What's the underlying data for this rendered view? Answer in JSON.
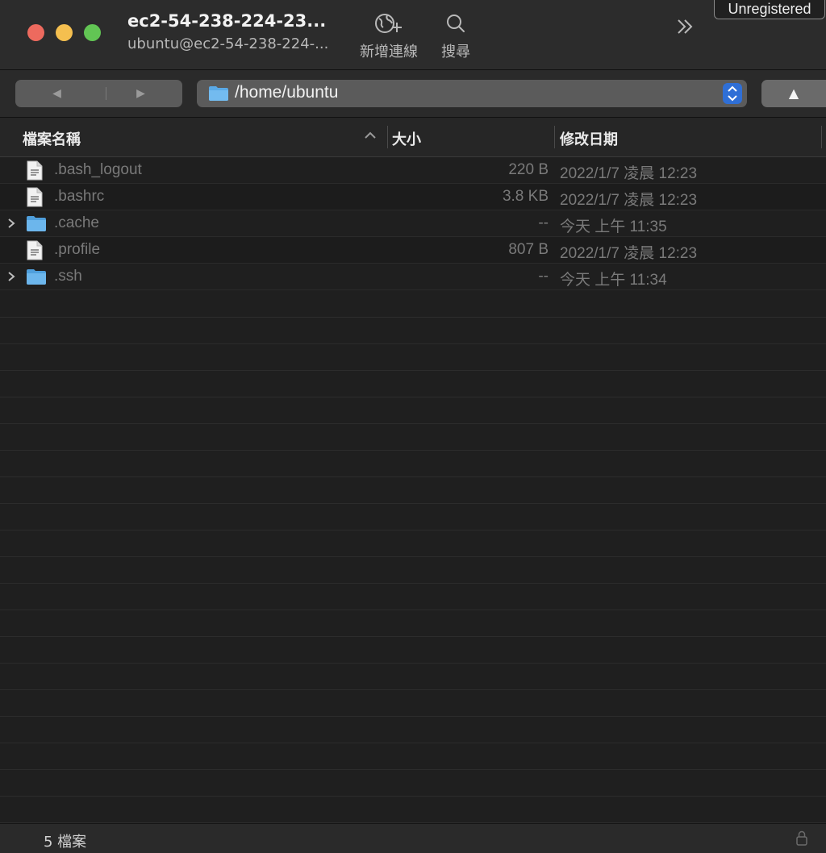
{
  "window": {
    "title": "ec2-54-238-224-23...",
    "subtitle": "ubuntu@ec2-54-238-224-..."
  },
  "toolbar": {
    "new_connection_label": "新增連線",
    "search_label": "搜尋",
    "badge": "Unregistered"
  },
  "nav": {
    "path": "/home/ubuntu"
  },
  "columns": {
    "name": "檔案名稱",
    "size": "大小",
    "modified": "修改日期"
  },
  "files": [
    {
      "name": ".bash_logout",
      "size": "220 B",
      "modified": "2022/1/7 凌晨 12:23",
      "kind": "file"
    },
    {
      "name": ".bashrc",
      "size": "3.8 KB",
      "modified": "2022/1/7 凌晨 12:23",
      "kind": "file"
    },
    {
      "name": ".cache",
      "size": "--",
      "modified": "今天 上午 11:35",
      "kind": "folder"
    },
    {
      "name": ".profile",
      "size": "807 B",
      "modified": "2022/1/7 凌晨 12:23",
      "kind": "file"
    },
    {
      "name": ".ssh",
      "size": "--",
      "modified": "今天 上午 11:34",
      "kind": "folder"
    }
  ],
  "status": {
    "count": "5 檔案"
  },
  "colors": {
    "accent": "#2f6fd6",
    "folder": "#5aa9e6"
  }
}
